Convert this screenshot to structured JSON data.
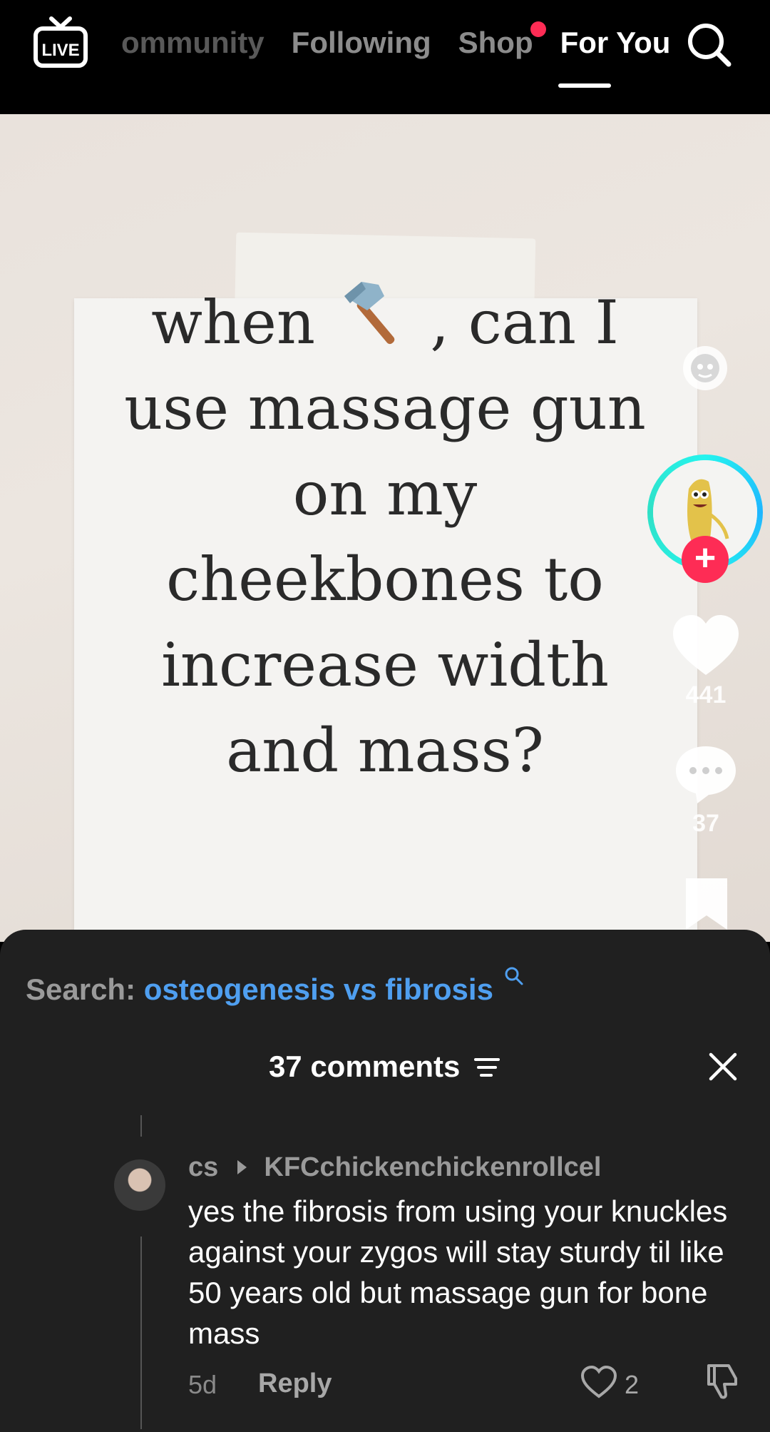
{
  "topnav": {
    "live_icon": "live-tv-icon",
    "tabs": [
      {
        "label": "ommunity",
        "state": "inactive-partial"
      },
      {
        "label": "Following",
        "state": "inactive"
      },
      {
        "label": "Shop",
        "state": "inactive",
        "badge": "red-dot"
      },
      {
        "label": "For You",
        "state": "active"
      }
    ],
    "search_icon": "search-icon"
  },
  "video": {
    "question_parts": [
      "when",
      ", can I use massage gun on my cheekbones to increase width and mass?"
    ],
    "emoji": "hammer-icon",
    "likes": "441",
    "comments": "37"
  },
  "sheet": {
    "search_label": "Search:",
    "search_query": "osteogenesis vs fibrosis",
    "title": "37 comments",
    "comment": {
      "author": "cs",
      "reply_to": "KFCchickenchickenrollcel",
      "text": "yes the fibrosis from using your knuckles against your zygos will stay sturdy til like 50 years old but massage gun for bone mass",
      "time": "5d",
      "reply_label": "Reply",
      "likes": "2"
    }
  },
  "colors": {
    "accent_red": "#fe2c55",
    "link_blue": "#4f9ff0",
    "sheet_bg": "#202020"
  }
}
